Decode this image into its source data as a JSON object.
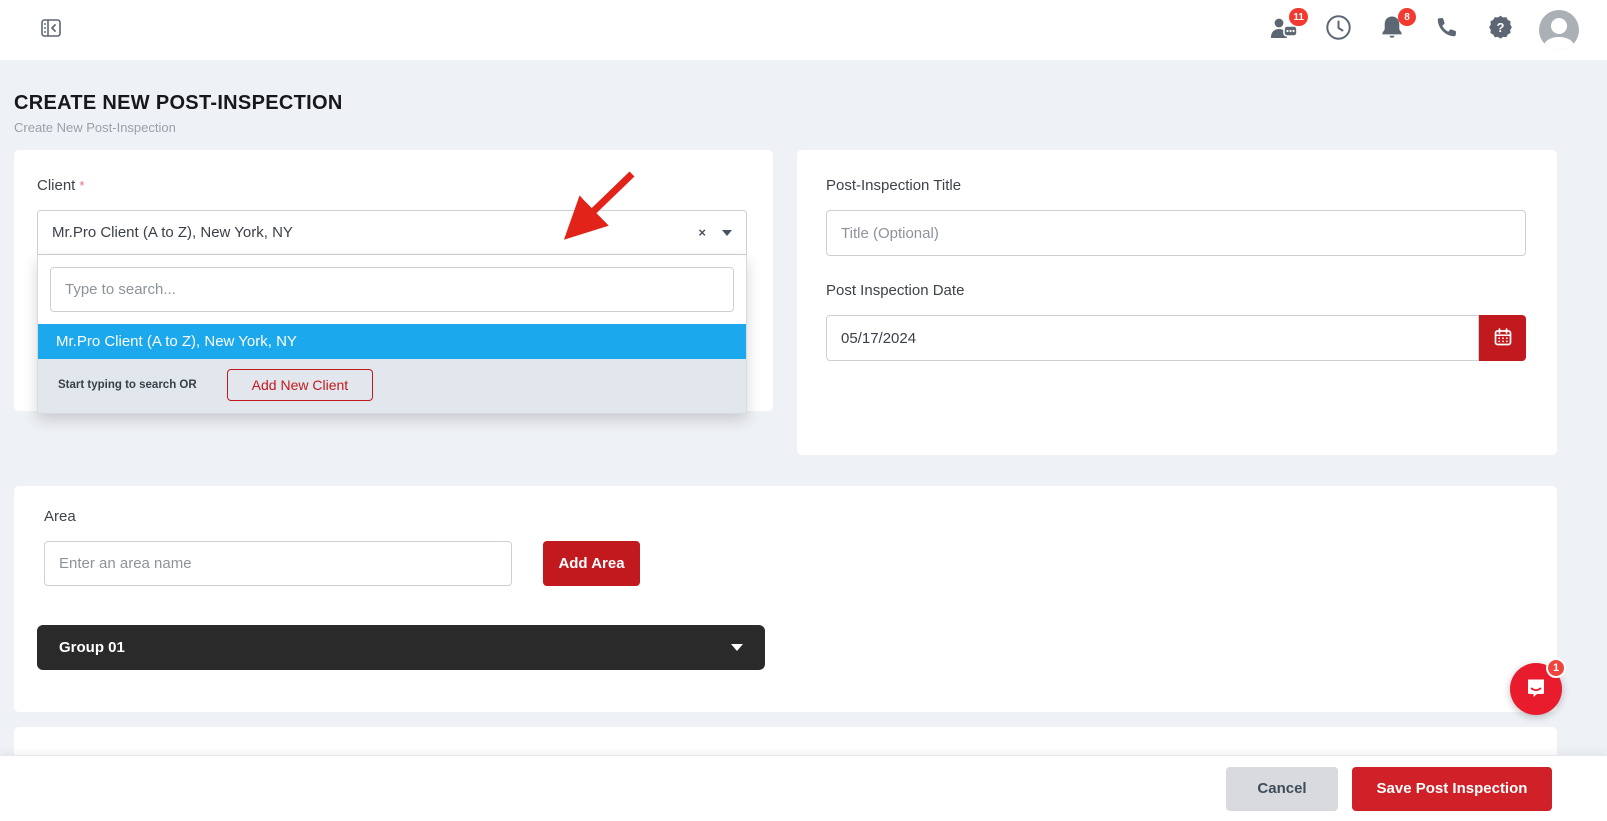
{
  "topbar": {
    "community_badge": "11",
    "notifications_badge": "8"
  },
  "page": {
    "title": "CREATE NEW POST-INSPECTION",
    "subtitle": "Create New Post-Inspection"
  },
  "client_section": {
    "label": "Client",
    "required_mark": "*",
    "selected_value": "Mr.Pro Client (A to Z), New York, NY",
    "clear_glyph": "×",
    "dropdown": {
      "search_placeholder": "Type to search...",
      "options": [
        "Mr.Pro Client (A to Z), New York, NY"
      ],
      "footer_text": "Start typing to search OR",
      "add_button_label": "Add New Client"
    }
  },
  "details_section": {
    "title_label": "Post-Inspection Title",
    "title_placeholder": "Title (Optional)",
    "date_label": "Post Inspection Date",
    "date_value": "05/17/2024"
  },
  "area_section": {
    "label": "Area",
    "input_placeholder": "Enter an area name",
    "add_button_label": "Add Area",
    "group_header": "Group 01"
  },
  "footer": {
    "cancel_label": "Cancel",
    "save_label": "Save Post Inspection"
  },
  "chat": {
    "badge": "1"
  },
  "colors": {
    "accent_red": "#c2191e",
    "save_red": "#cf2127",
    "option_blue": "#1ba8ec",
    "page_background": "#eef1f6",
    "group_bar": "#2b2a2b",
    "badge_red": "#f23a31"
  }
}
